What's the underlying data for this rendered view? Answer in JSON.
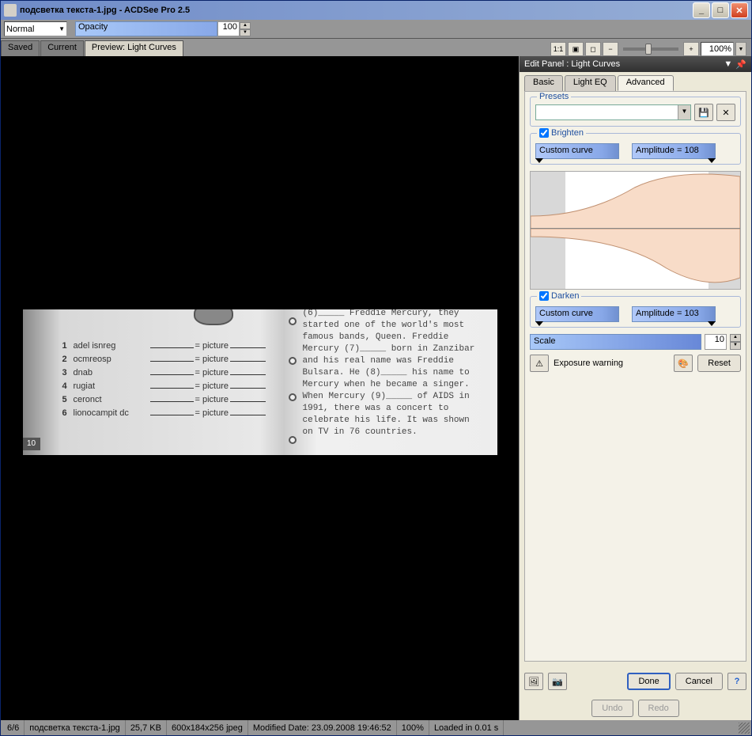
{
  "window": {
    "title": "подсветка текста-1.jpg - ACDSee Pro 2.5"
  },
  "toolbar": {
    "normal": "Normal",
    "opacity_label": "Opacity",
    "opacity_value": "100"
  },
  "tabs": {
    "saved": "Saved",
    "current": "Current",
    "preview": "Preview: Light Curves",
    "zoom": "100%",
    "one_to_one": "1:1"
  },
  "panel": {
    "title": "Edit Panel : Light Curves",
    "tabs": {
      "basic": "Basic",
      "lighteq": "Light EQ",
      "advanced": "Advanced"
    },
    "presets_label": "Presets",
    "brighten": {
      "label": "Brighten",
      "checked": true,
      "curve": "Custom curve",
      "amplitude": "Amplitude = 108"
    },
    "darken": {
      "label": "Darken",
      "checked": true,
      "curve": "Custom curve",
      "amplitude": "Amplitude = 103"
    },
    "scale_label": "Scale",
    "scale_value": "10",
    "exposure_warning": "Exposure warning",
    "reset": "Reset",
    "done": "Done",
    "cancel": "Cancel",
    "undo": "Undo",
    "redo": "Redo"
  },
  "photo": {
    "page_num": "10",
    "left_rows": [
      {
        "n": "1",
        "w": "adel isnreg",
        "eq": "= picture"
      },
      {
        "n": "2",
        "w": "ocmreosp",
        "eq": "= picture"
      },
      {
        "n": "3",
        "w": "dnab",
        "eq": "= picture"
      },
      {
        "n": "4",
        "w": "rugiat",
        "eq": "= picture"
      },
      {
        "n": "5",
        "w": "ceronct",
        "eq": "= picture"
      },
      {
        "n": "6",
        "w": "lionocampit dc",
        "eq": "= picture"
      }
    ],
    "right_text": "(6)_____ Freddie Mercury, they started one of the world's most famous bands, Queen. Freddie Mercury (7)_____ born in Zanzibar and his real name was Freddie Bulsara. He (8)_____ his name to Mercury when he became a singer. When Mercury (9)_____ of AIDS in 1991, there was a concert to celebrate his life. It was shown on TV in 76 countries."
  },
  "status": {
    "idx": "6/6",
    "file": "подсветка текста-1.jpg",
    "size": "25,7 KB",
    "dims": "600x184x256 jpeg",
    "modified": "Modified Date: 23.09.2008 19:46:52",
    "zoom": "100%",
    "loaded": "Loaded in 0.01 s"
  }
}
